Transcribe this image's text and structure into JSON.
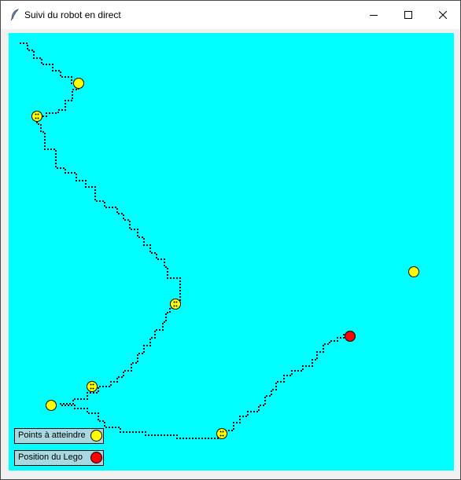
{
  "window": {
    "title": "Suivi du robot en direct",
    "icon": "feather-icon",
    "controls": [
      "minimize-icon",
      "maximize-icon",
      "close-icon"
    ]
  },
  "colors": {
    "canvas_background": "#00ffff",
    "target_point": "#ffff00",
    "robot_position": "#ff0000",
    "path": "#000000",
    "legend_background": "#a8d8e0"
  },
  "legend": {
    "targets_label": "Points à atteindre",
    "robot_label": "Position du Lego"
  }
}
